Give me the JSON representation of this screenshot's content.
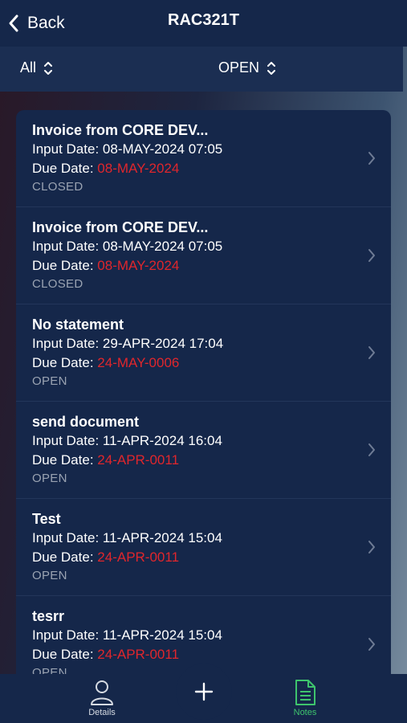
{
  "header": {
    "back_label": "Back",
    "title": "RAC321T"
  },
  "filters": {
    "type_value": "All",
    "status_value": "OPEN"
  },
  "items": [
    {
      "title": "Invoice from CORE DEV...",
      "input_label": "Input Date:",
      "input_date": "08-MAY-2024 07:05",
      "due_label": "Due Date:",
      "due_date": "08-MAY-2024",
      "status": "CLOSED"
    },
    {
      "title": "Invoice from CORE DEV...",
      "input_label": "Input Date:",
      "input_date": "08-MAY-2024 07:05",
      "due_label": "Due Date:",
      "due_date": "08-MAY-2024",
      "status": "CLOSED"
    },
    {
      "title": "No statement",
      "input_label": "Input Date:",
      "input_date": "29-APR-2024 17:04",
      "due_label": "Due Date:",
      "due_date": "24-MAY-0006",
      "status": "OPEN"
    },
    {
      "title": "send document",
      "input_label": "Input Date:",
      "input_date": "11-APR-2024 16:04",
      "due_label": "Due Date:",
      "due_date": "24-APR-0011",
      "status": "OPEN"
    },
    {
      "title": "Test",
      "input_label": "Input Date:",
      "input_date": "11-APR-2024 15:04",
      "due_label": "Due Date:",
      "due_date": "24-APR-0011",
      "status": "OPEN"
    },
    {
      "title": "tesrr",
      "input_label": "Input Date:",
      "input_date": "11-APR-2024 15:04",
      "due_label": "Due Date:",
      "due_date": "24-APR-0011",
      "status": "OPEN"
    }
  ],
  "tabs": {
    "details_label": "Details",
    "notes_label": "Notes",
    "active": "Notes"
  },
  "colors": {
    "due_date": "#e0262c",
    "active_tab": "#3ec46d",
    "panel": "#15274a"
  },
  "icons": {
    "back": "chevron-left-icon",
    "sort": "up-down-chevron-icon",
    "row": "chevron-right-icon",
    "details": "person-icon",
    "add": "plus-icon",
    "notes": "document-icon"
  }
}
